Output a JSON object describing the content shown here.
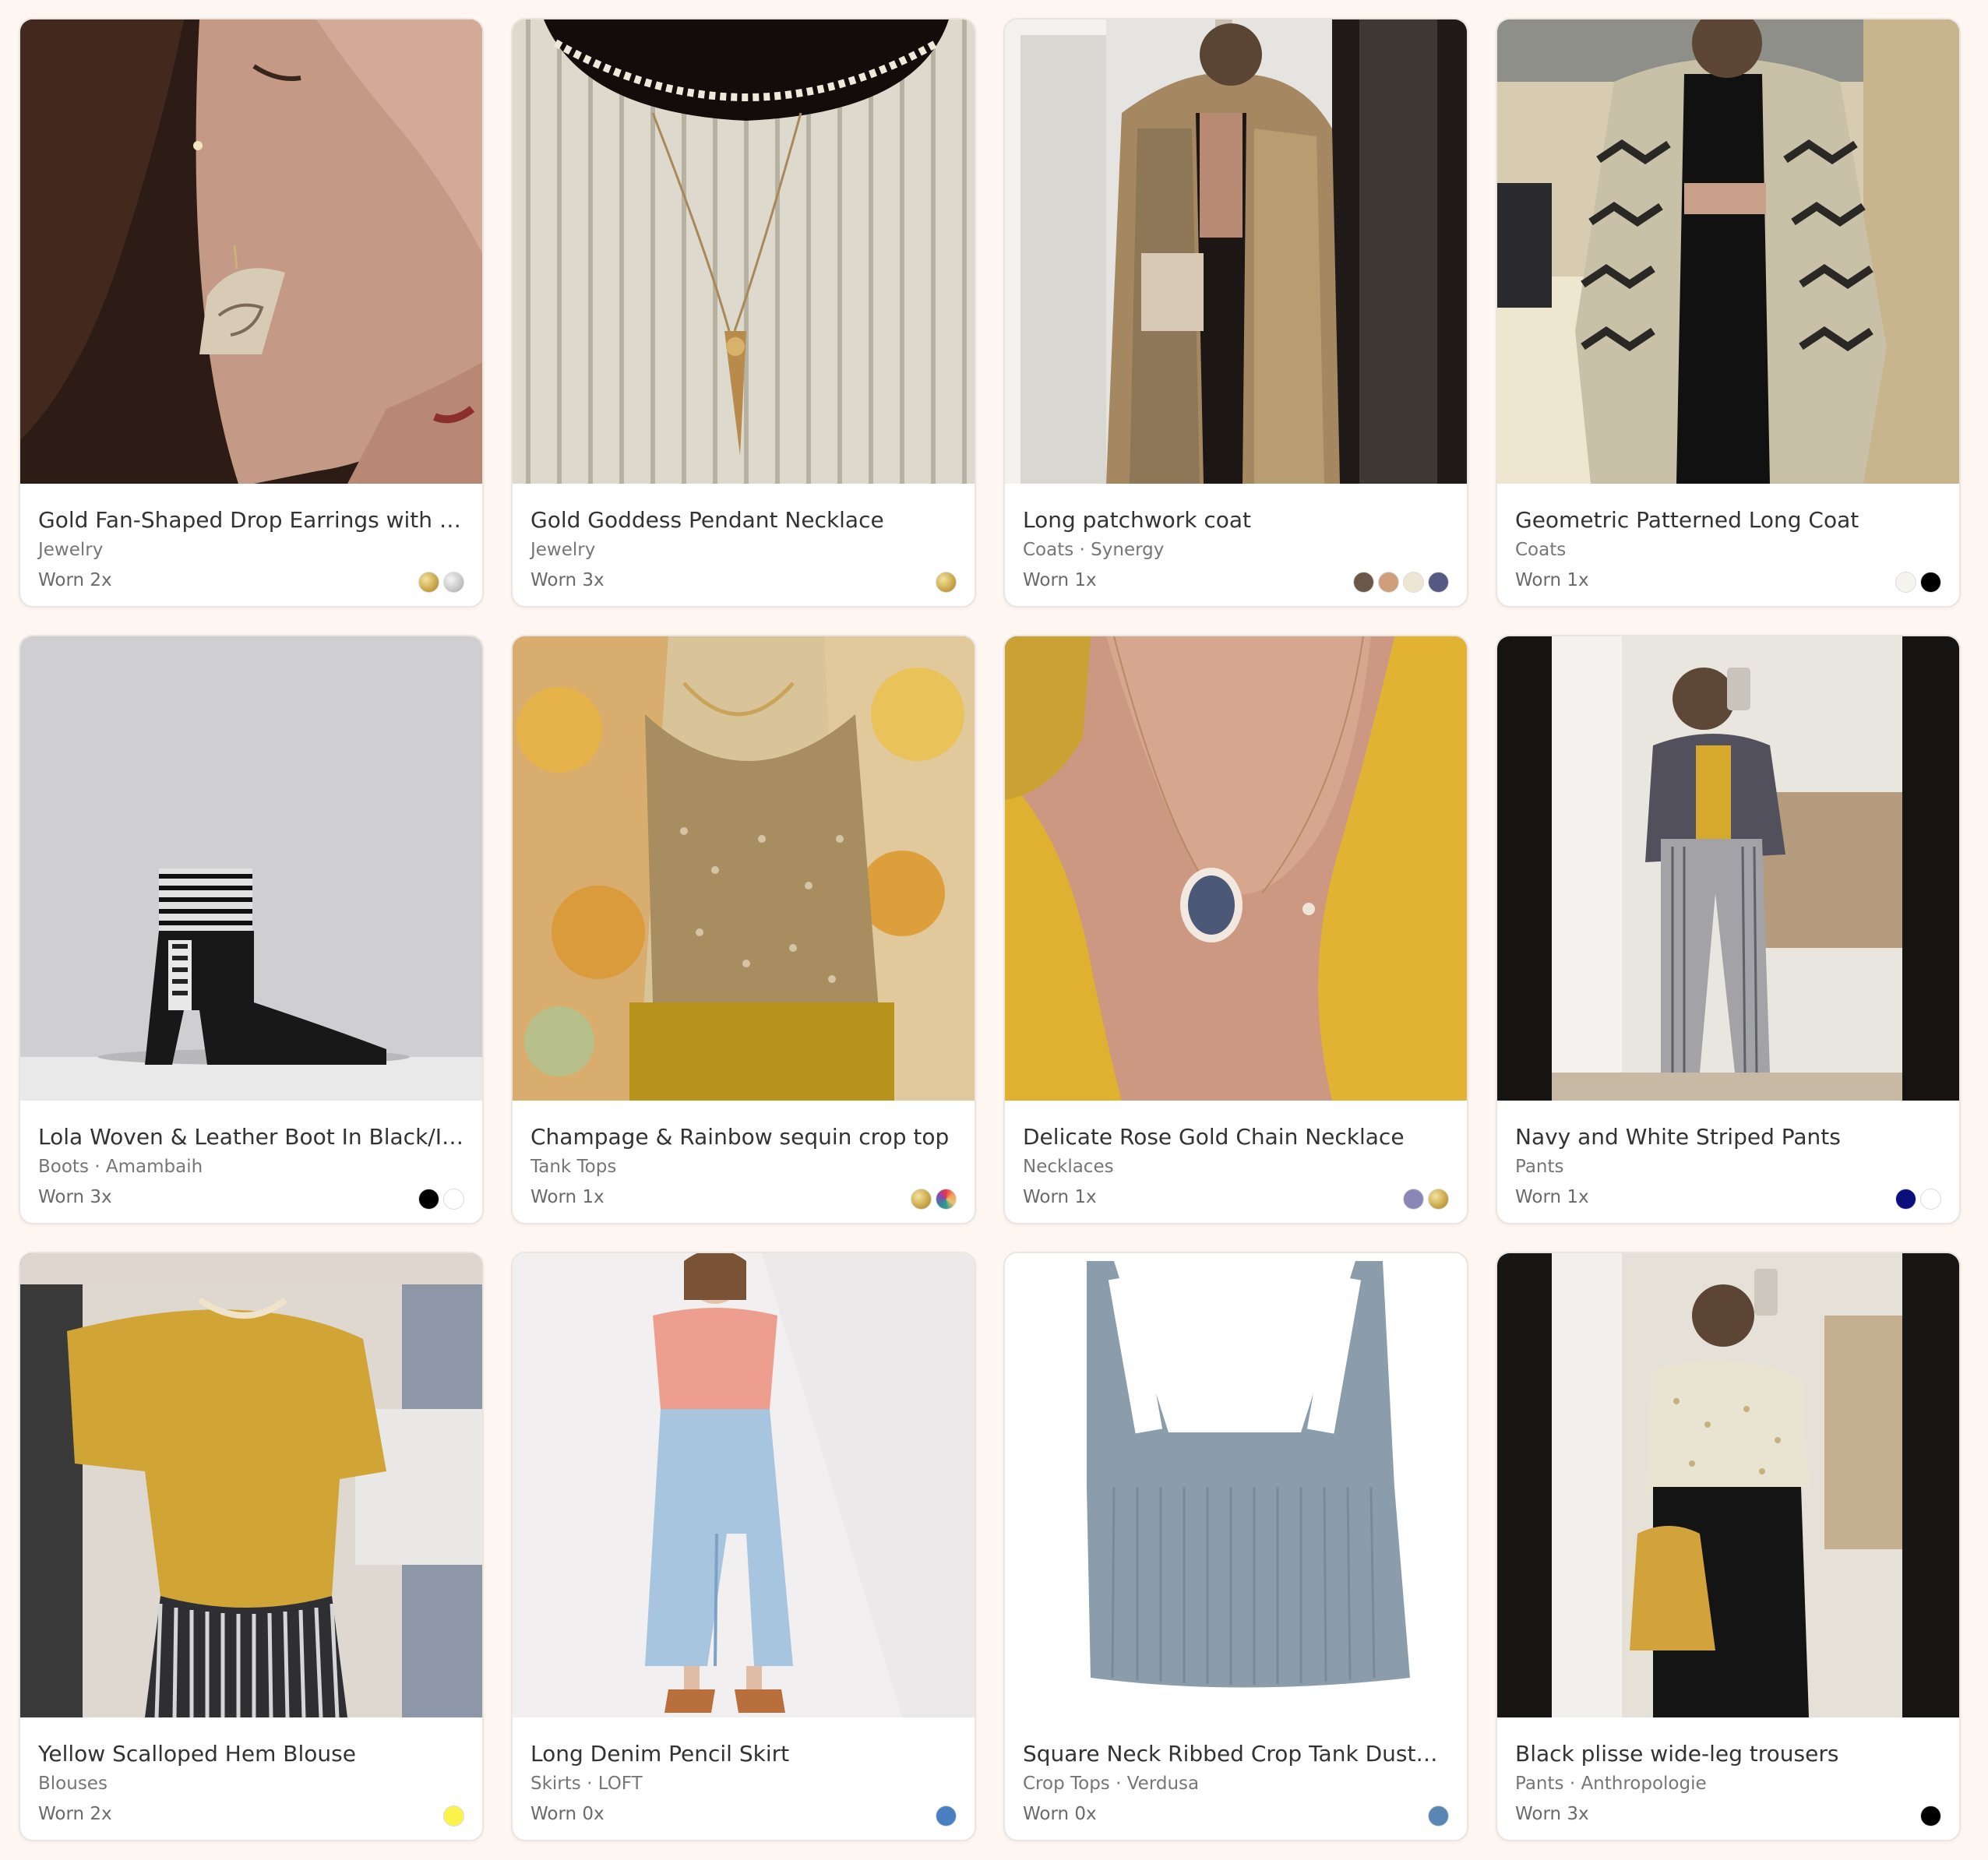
{
  "items": [
    {
      "title": "Gold Fan-Shaped Drop Earrings with Abs...",
      "subtitle": "Jewelry",
      "worn": "Worn 2x",
      "colors": [
        "gold",
        "silver"
      ],
      "photo": "earring"
    },
    {
      "title": "Gold Goddess Pendant Necklace",
      "subtitle": "Jewelry",
      "worn": "Worn 3x",
      "colors": [
        "gold"
      ],
      "photo": "necklace"
    },
    {
      "title": "Long patchwork coat",
      "subtitle": "Coats · Synergy",
      "worn": "Worn 1x",
      "colors": [
        "#6b5848",
        "#cf9f7c",
        "#ede6d2",
        "#565a82"
      ],
      "photo": "patchcoat"
    },
    {
      "title": "Geometric Patterned Long Coat",
      "subtitle": "Coats",
      "worn": "Worn 1x",
      "colors": [
        "#f6f4ef",
        "#000000"
      ],
      "photo": "geocoat"
    },
    {
      "title": "Lola Woven & Leather Boot In Black/Ivory",
      "subtitle": "Boots · Amambaih",
      "worn": "Worn 3x",
      "colors": [
        "#000000",
        "#ffffff"
      ],
      "photo": "boot"
    },
    {
      "title": "Champage & Rainbow sequin crop top",
      "subtitle": "Tank Tops",
      "worn": "Worn 1x",
      "colors": [
        "gold",
        "rainbow"
      ],
      "photo": "sequin"
    },
    {
      "title": "Delicate Rose Gold Chain Necklace",
      "subtitle": "Necklaces",
      "worn": "Worn 1x",
      "colors": [
        "#8a87b7",
        "gold"
      ],
      "photo": "rosechain"
    },
    {
      "title": "Navy and White Striped Pants",
      "subtitle": "Pants",
      "worn": "Worn 1x",
      "colors": [
        "#0b0f7c",
        "#ffffff"
      ],
      "photo": "mirror-stripes"
    },
    {
      "title": "Yellow Scalloped Hem Blouse",
      "subtitle": "Blouses",
      "worn": "Worn 2x",
      "colors": [
        "#fbf34a"
      ],
      "photo": "yellowblouse"
    },
    {
      "title": "Long Denim Pencil Skirt",
      "subtitle": "Skirts · LOFT",
      "worn": "Worn 0x",
      "colors": [
        "#4a7fc0"
      ],
      "photo": "denimskirt"
    },
    {
      "title": "Square Neck Ribbed Crop Tank Dusty Blue",
      "subtitle": "Crop Tops · Verdusa",
      "worn": "Worn 0x",
      "colors": [
        "#5a86b3"
      ],
      "photo": "bluetank"
    },
    {
      "title": "Black plisse wide-leg trousers",
      "subtitle": "Pants · Anthropologie",
      "worn": "Worn 3x",
      "colors": [
        "#000000"
      ],
      "photo": "mirror-trousers"
    }
  ]
}
